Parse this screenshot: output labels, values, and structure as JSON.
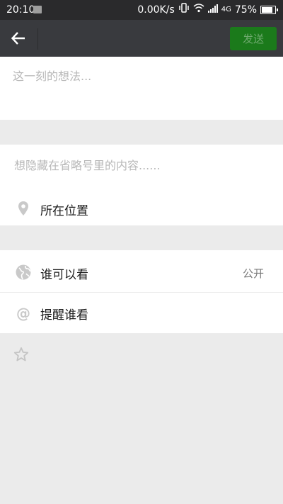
{
  "status_bar": {
    "time": "20:10",
    "net_speed": "0.00K/s",
    "network": "4G",
    "battery": "75%"
  },
  "nav": {
    "send_label": "发送"
  },
  "post": {
    "placeholder": "这一刻的想法..."
  },
  "fold": {
    "placeholder": "想隐藏在省略号里的内容......"
  },
  "location": {
    "label": "所在位置"
  },
  "privacy": {
    "who_can_see_label": "谁可以看",
    "who_can_see_value": "公开",
    "remind_label": "提醒谁看"
  },
  "colors": {
    "navbar": "#393a3e",
    "statusbar": "#2a2a2c",
    "send_button": "#1b7a1b",
    "background": "#ebebeb"
  }
}
